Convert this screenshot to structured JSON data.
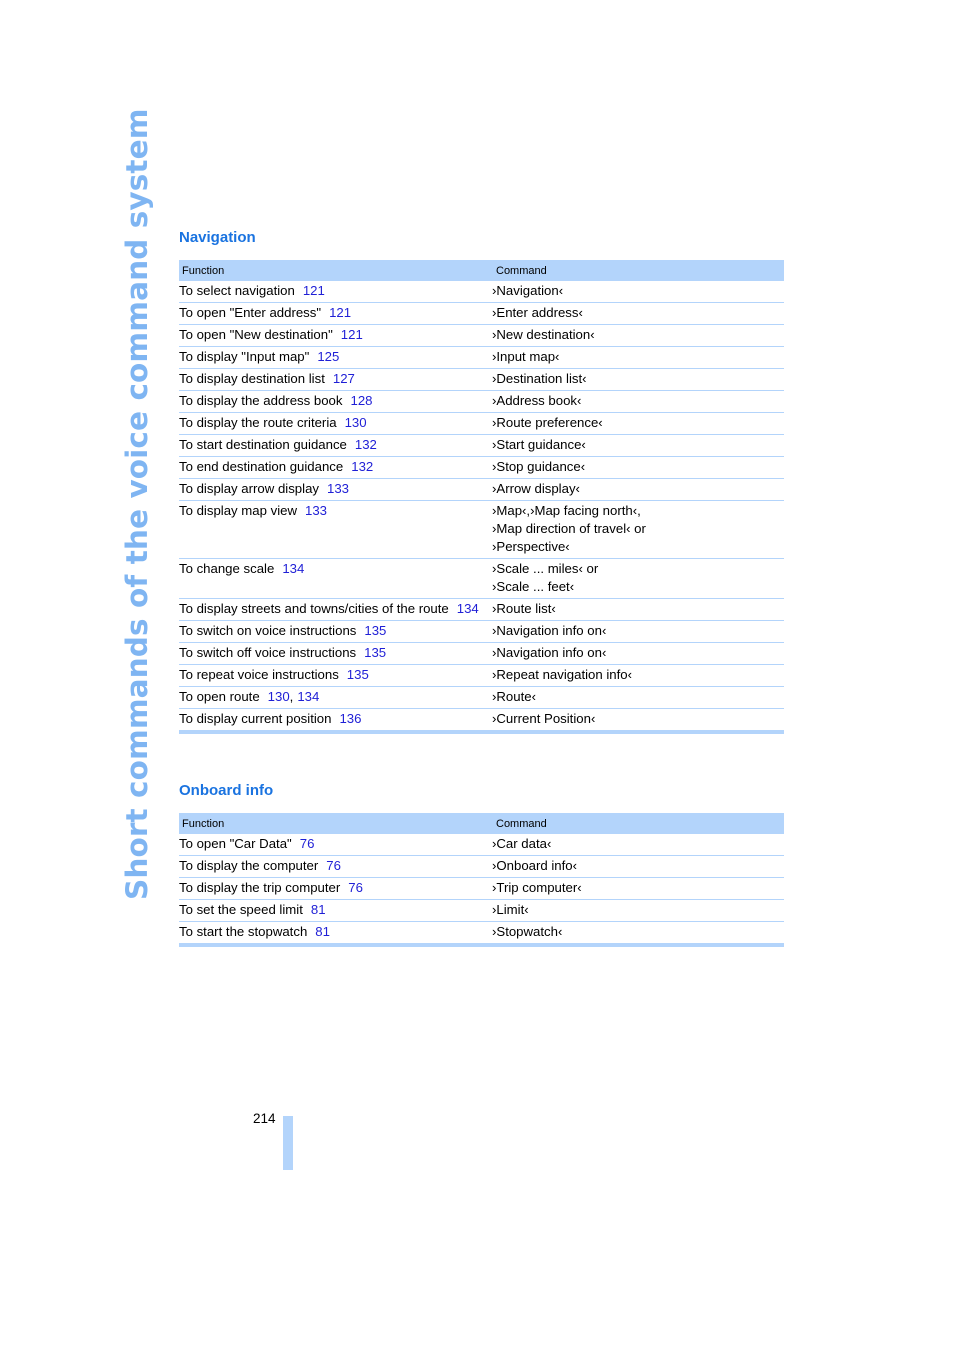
{
  "side_title": "Short commands of the voice command system",
  "page_number": "214",
  "colors": {
    "accent": "#1a73e0",
    "header_bg": "#b3d4fb",
    "link": "#1f1fd6",
    "side_title": "#7fb5f2"
  },
  "sections": [
    {
      "title": "Navigation",
      "headers": {
        "function": "Function",
        "command": "Command"
      },
      "rows": [
        {
          "function": "To select navigation",
          "refs": [
            "121"
          ],
          "command": [
            "›Navigation‹"
          ]
        },
        {
          "function": "To open \"Enter address\"",
          "refs": [
            "121"
          ],
          "command": [
            "›Enter address‹"
          ]
        },
        {
          "function": "To open \"New destination\"",
          "refs": [
            "121"
          ],
          "command": [
            "›New destination‹"
          ]
        },
        {
          "function": "To display \"Input map\"",
          "refs": [
            "125"
          ],
          "command": [
            "›Input map‹"
          ]
        },
        {
          "function": "To display destination list",
          "refs": [
            "127"
          ],
          "command": [
            "›Destination list‹"
          ]
        },
        {
          "function": "To display the address book",
          "refs": [
            "128"
          ],
          "command": [
            "›Address book‹"
          ]
        },
        {
          "function": "To display the route criteria",
          "refs": [
            "130"
          ],
          "command": [
            "›Route preference‹"
          ]
        },
        {
          "function": "To start destination guidance",
          "refs": [
            "132"
          ],
          "command": [
            "›Start guidance‹"
          ]
        },
        {
          "function": "To end destination guidance",
          "refs": [
            "132"
          ],
          "command": [
            "›Stop guidance‹"
          ]
        },
        {
          "function": "To display arrow display",
          "refs": [
            "133"
          ],
          "command": [
            "›Arrow display‹"
          ]
        },
        {
          "function": "To display map view",
          "refs": [
            "133"
          ],
          "command": [
            "›Map‹,›Map facing north‹,",
            "›Map direction of travel‹ or",
            "›Perspective‹"
          ]
        },
        {
          "function": "To change scale",
          "refs": [
            "134"
          ],
          "command": [
            "›Scale ... miles‹ or",
            "›Scale ... feet‹"
          ]
        },
        {
          "function": "To display streets and towns/cities of the route",
          "refs": [
            "134"
          ],
          "command": [
            "›Route list‹"
          ]
        },
        {
          "function": "To switch on voice instructions",
          "refs": [
            "135"
          ],
          "command": [
            "›Navigation info on‹"
          ]
        },
        {
          "function": "To switch off voice instructions",
          "refs": [
            "135"
          ],
          "command": [
            "›Navigation info on‹"
          ]
        },
        {
          "function": "To repeat voice instructions",
          "refs": [
            "135"
          ],
          "command": [
            "›Repeat navigation info‹"
          ]
        },
        {
          "function": "To open route",
          "refs": [
            "130",
            "134"
          ],
          "command": [
            "›Route‹"
          ]
        },
        {
          "function": "To display current position",
          "refs": [
            "136"
          ],
          "command": [
            "›Current Position‹"
          ]
        }
      ]
    },
    {
      "title": "Onboard info",
      "headers": {
        "function": "Function",
        "command": "Command"
      },
      "rows": [
        {
          "function": "To open \"Car Data\"",
          "refs": [
            "76"
          ],
          "command": [
            "›Car data‹"
          ]
        },
        {
          "function": "To display the computer",
          "refs": [
            "76"
          ],
          "command": [
            "›Onboard info‹"
          ]
        },
        {
          "function": "To display the trip computer",
          "refs": [
            "76"
          ],
          "command": [
            "›Trip computer‹"
          ]
        },
        {
          "function": "To set the speed limit",
          "refs": [
            "81"
          ],
          "command": [
            "›Limit‹"
          ]
        },
        {
          "function": "To start the stopwatch",
          "refs": [
            "81"
          ],
          "command": [
            "›Stopwatch‹"
          ]
        }
      ]
    }
  ]
}
